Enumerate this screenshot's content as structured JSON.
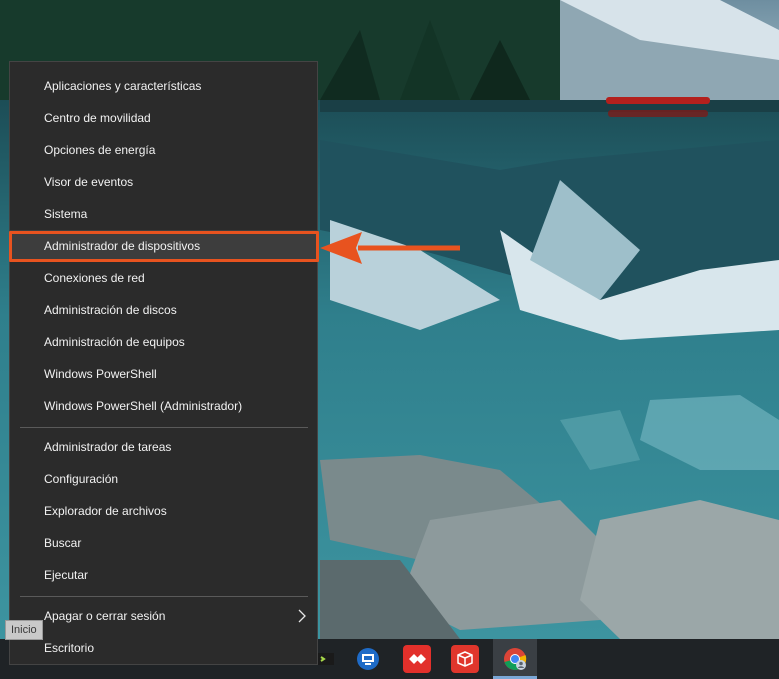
{
  "menu": {
    "items": [
      {
        "label": "Aplicaciones y características"
      },
      {
        "label": "Centro de movilidad"
      },
      {
        "label": "Opciones de energía"
      },
      {
        "label": "Visor de eventos"
      },
      {
        "label": "Sistema"
      },
      {
        "label": "Administrador de dispositivos"
      },
      {
        "label": "Conexiones de red"
      },
      {
        "label": "Administración de discos"
      },
      {
        "label": "Administración de equipos"
      },
      {
        "label": "Windows PowerShell"
      },
      {
        "label": "Windows PowerShell (Administrador)"
      },
      {
        "label": "Administrador de tareas"
      },
      {
        "label": "Configuración"
      },
      {
        "label": "Explorador de archivos"
      },
      {
        "label": "Buscar"
      },
      {
        "label": "Ejecutar"
      },
      {
        "label": "Apagar o cerrar sesión"
      },
      {
        "label": "Escritorio"
      }
    ]
  },
  "tooltip": {
    "text": "Inicio"
  },
  "colors": {
    "highlight": "#e8531f",
    "menu_bg": "#2b2b2b",
    "taskbar_bg": "#1f2326"
  },
  "taskbar": {
    "icons": [
      "terminal-icon",
      "remote-desktop-icon",
      "anydesk-icon",
      "3d-box-app-icon",
      "chrome-icon"
    ]
  }
}
